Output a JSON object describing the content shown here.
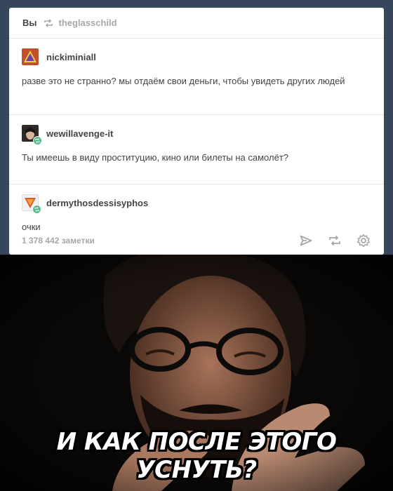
{
  "post": {
    "header": {
      "you_label": "Вы",
      "blog_name": "theglasschild"
    },
    "entries": [
      {
        "username": "nickiminiall",
        "text": "разве это не странно? мы отдаём свои деньги, чтобы увидеть других людей",
        "avatar_color": "#c1502e"
      },
      {
        "username": "wewillavenge-it",
        "text": "Ты имеешь в виду проституцию, кино или билеты на самолёт?",
        "avatar_color": "#2e2a28"
      },
      {
        "username": "dermythosdessisyphos",
        "text": "очки",
        "avatar_color": "#f1f1f1"
      }
    ],
    "footer": {
      "notes": "1 378 442 заметки",
      "icons": [
        "send-icon",
        "reblog-icon",
        "gear-icon"
      ]
    }
  },
  "photo": {
    "caption": "И КАК ПОСЛЕ ЭТОГО УСНУТЬ?"
  },
  "colors": {
    "background": "#36465d",
    "text": "#444444",
    "muted": "#a7a7a7",
    "reblog_badge": "#56bc8a"
  }
}
